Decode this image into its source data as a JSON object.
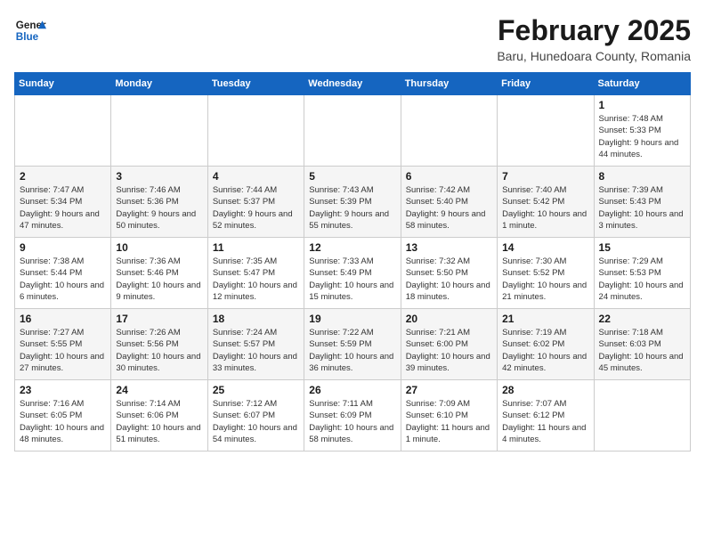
{
  "header": {
    "logo_general": "General",
    "logo_blue": "Blue",
    "title": "February 2025",
    "subtitle": "Baru, Hunedoara County, Romania"
  },
  "days_of_week": [
    "Sunday",
    "Monday",
    "Tuesday",
    "Wednesday",
    "Thursday",
    "Friday",
    "Saturday"
  ],
  "weeks": [
    [
      {
        "day": "",
        "info": ""
      },
      {
        "day": "",
        "info": ""
      },
      {
        "day": "",
        "info": ""
      },
      {
        "day": "",
        "info": ""
      },
      {
        "day": "",
        "info": ""
      },
      {
        "day": "",
        "info": ""
      },
      {
        "day": "1",
        "info": "Sunrise: 7:48 AM\nSunset: 5:33 PM\nDaylight: 9 hours and 44 minutes."
      }
    ],
    [
      {
        "day": "2",
        "info": "Sunrise: 7:47 AM\nSunset: 5:34 PM\nDaylight: 9 hours and 47 minutes."
      },
      {
        "day": "3",
        "info": "Sunrise: 7:46 AM\nSunset: 5:36 PM\nDaylight: 9 hours and 50 minutes."
      },
      {
        "day": "4",
        "info": "Sunrise: 7:44 AM\nSunset: 5:37 PM\nDaylight: 9 hours and 52 minutes."
      },
      {
        "day": "5",
        "info": "Sunrise: 7:43 AM\nSunset: 5:39 PM\nDaylight: 9 hours and 55 minutes."
      },
      {
        "day": "6",
        "info": "Sunrise: 7:42 AM\nSunset: 5:40 PM\nDaylight: 9 hours and 58 minutes."
      },
      {
        "day": "7",
        "info": "Sunrise: 7:40 AM\nSunset: 5:42 PM\nDaylight: 10 hours and 1 minute."
      },
      {
        "day": "8",
        "info": "Sunrise: 7:39 AM\nSunset: 5:43 PM\nDaylight: 10 hours and 3 minutes."
      }
    ],
    [
      {
        "day": "9",
        "info": "Sunrise: 7:38 AM\nSunset: 5:44 PM\nDaylight: 10 hours and 6 minutes."
      },
      {
        "day": "10",
        "info": "Sunrise: 7:36 AM\nSunset: 5:46 PM\nDaylight: 10 hours and 9 minutes."
      },
      {
        "day": "11",
        "info": "Sunrise: 7:35 AM\nSunset: 5:47 PM\nDaylight: 10 hours and 12 minutes."
      },
      {
        "day": "12",
        "info": "Sunrise: 7:33 AM\nSunset: 5:49 PM\nDaylight: 10 hours and 15 minutes."
      },
      {
        "day": "13",
        "info": "Sunrise: 7:32 AM\nSunset: 5:50 PM\nDaylight: 10 hours and 18 minutes."
      },
      {
        "day": "14",
        "info": "Sunrise: 7:30 AM\nSunset: 5:52 PM\nDaylight: 10 hours and 21 minutes."
      },
      {
        "day": "15",
        "info": "Sunrise: 7:29 AM\nSunset: 5:53 PM\nDaylight: 10 hours and 24 minutes."
      }
    ],
    [
      {
        "day": "16",
        "info": "Sunrise: 7:27 AM\nSunset: 5:55 PM\nDaylight: 10 hours and 27 minutes."
      },
      {
        "day": "17",
        "info": "Sunrise: 7:26 AM\nSunset: 5:56 PM\nDaylight: 10 hours and 30 minutes."
      },
      {
        "day": "18",
        "info": "Sunrise: 7:24 AM\nSunset: 5:57 PM\nDaylight: 10 hours and 33 minutes."
      },
      {
        "day": "19",
        "info": "Sunrise: 7:22 AM\nSunset: 5:59 PM\nDaylight: 10 hours and 36 minutes."
      },
      {
        "day": "20",
        "info": "Sunrise: 7:21 AM\nSunset: 6:00 PM\nDaylight: 10 hours and 39 minutes."
      },
      {
        "day": "21",
        "info": "Sunrise: 7:19 AM\nSunset: 6:02 PM\nDaylight: 10 hours and 42 minutes."
      },
      {
        "day": "22",
        "info": "Sunrise: 7:18 AM\nSunset: 6:03 PM\nDaylight: 10 hours and 45 minutes."
      }
    ],
    [
      {
        "day": "23",
        "info": "Sunrise: 7:16 AM\nSunset: 6:05 PM\nDaylight: 10 hours and 48 minutes."
      },
      {
        "day": "24",
        "info": "Sunrise: 7:14 AM\nSunset: 6:06 PM\nDaylight: 10 hours and 51 minutes."
      },
      {
        "day": "25",
        "info": "Sunrise: 7:12 AM\nSunset: 6:07 PM\nDaylight: 10 hours and 54 minutes."
      },
      {
        "day": "26",
        "info": "Sunrise: 7:11 AM\nSunset: 6:09 PM\nDaylight: 10 hours and 58 minutes."
      },
      {
        "day": "27",
        "info": "Sunrise: 7:09 AM\nSunset: 6:10 PM\nDaylight: 11 hours and 1 minute."
      },
      {
        "day": "28",
        "info": "Sunrise: 7:07 AM\nSunset: 6:12 PM\nDaylight: 11 hours and 4 minutes."
      },
      {
        "day": "",
        "info": ""
      }
    ]
  ]
}
